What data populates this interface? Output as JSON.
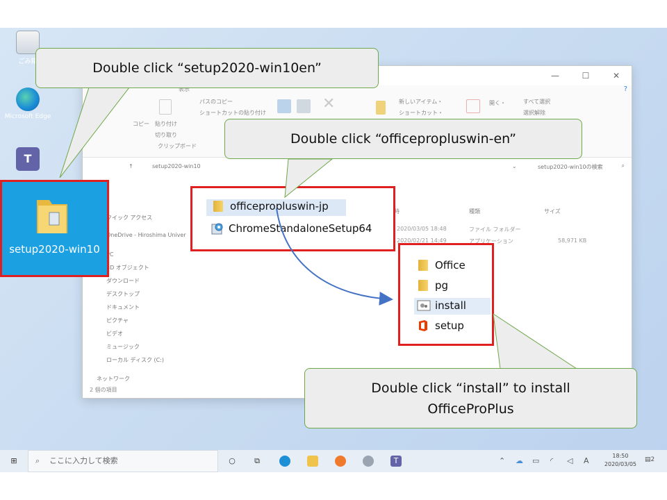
{
  "desktop": {
    "icons": [
      {
        "label": "ごみ箱"
      },
      {
        "label": "Microsoft Edge"
      },
      {
        "label": ""
      }
    ],
    "selected_folder": {
      "label": "setup2020-win10"
    }
  },
  "explorer": {
    "ribbon": {
      "tab": "表示",
      "copy_path": "パスのコピー",
      "paste_shortcut": "ショートカットの貼り付け",
      "copy": "コピー",
      "paste": "貼り付け",
      "cut": "切り取り",
      "clipboard": "クリップボード",
      "new_item": "新しいアイテム・",
      "shortcut": "ショートカット・",
      "open": "開く・",
      "select_all": "すべて選択",
      "deselect": "選択解除"
    },
    "address": {
      "path": "setup2020-win10",
      "search_placeholder": "setup2020-win10の検索"
    },
    "nav": [
      "クイック アクセス",
      "OneDrive - Hiroshima Univer",
      "PC",
      "3D オブジェクト",
      "ダウンロード",
      "デスクトップ",
      "ドキュメント",
      "ピクチャ",
      "ビデオ",
      "ミュージック",
      "ローカル ディスク (C:)",
      "ネットワーク"
    ],
    "columns": {
      "modified": "更新日時",
      "type": "種類",
      "size": "サイズ"
    },
    "rows": [
      {
        "date": "2020/03/05 18:48",
        "type": "ファイル フォルダー",
        "size": ""
      },
      {
        "date": "2020/02/21 14:49",
        "type": "アプリケーション",
        "size": "58,971 KB"
      }
    ],
    "status": "2 個の項目"
  },
  "box_root": {
    "items": [
      "officepropluswin-jp",
      "ChromeStandaloneSetup64"
    ]
  },
  "box_sub": {
    "items": [
      "Office",
      "pg",
      "install",
      "setup"
    ]
  },
  "callouts": {
    "first": "Double click “setup2020-win10en”",
    "second": "Double click “officepropluswin-en”",
    "third_line1": "Double click “install” to install",
    "third_line2": "OfficeProPlus"
  },
  "taskbar": {
    "search_placeholder": "ここに入力して検索",
    "ime": "A",
    "time": "18:50",
    "date": "2020/03/05",
    "notifications": "2"
  },
  "colors": {
    "highlight_box": "#e02020",
    "callout_border": "#6fa84a",
    "tile_blue": "#1ba1e2"
  }
}
